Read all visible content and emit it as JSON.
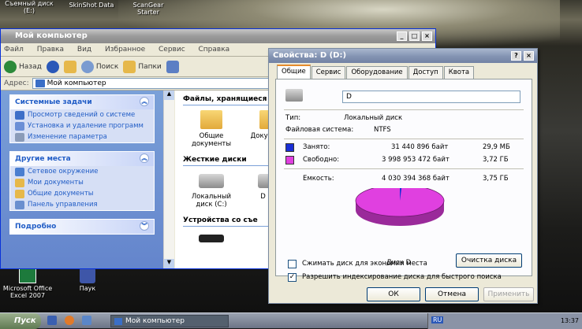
{
  "desktop": {
    "icons_top": [
      "Съемный диск\n(E:)",
      "SkinShot Data",
      "ScanGear\nStarter"
    ],
    "excel_icon": "Microsoft Office\nExcel 2007",
    "spider_icon": "Паук"
  },
  "explorer": {
    "title": "Мой компьютер",
    "menu": [
      "Файл",
      "Правка",
      "Вид",
      "Избранное",
      "Сервис",
      "Справка"
    ],
    "toolbar": {
      "back": "Назад",
      "search": "Поиск",
      "folders": "Папки"
    },
    "address_label": "Адрес:",
    "address_value": "Мой компьютер",
    "system_tasks": {
      "title": "Системные задачи",
      "items": [
        "Просмотр сведений о системе",
        "Установка и удаление программ",
        "Изменение параметра"
      ]
    },
    "other_places": {
      "title": "Другие места",
      "items": [
        "Сетевое окружение",
        "Мои документы",
        "Общие документы",
        "Панель управления"
      ]
    },
    "details": {
      "title": "Подробно"
    },
    "section_files": "Файлы, хранящиеся",
    "folders": [
      "Общие документы",
      "Докум Adm"
    ],
    "section_drives": "Жесткие диски",
    "drives": [
      "Локальный диск (C:)",
      "D (D:)"
    ],
    "section_devices": "Устройства со съе"
  },
  "dialog": {
    "title": "Свойства: D (D:)",
    "tabs": [
      "Общие",
      "Сервис",
      "Оборудование",
      "Доступ",
      "Квота"
    ],
    "selected_tab": "Общие",
    "name_value": "D",
    "type_label": "Тип:",
    "type_value": "Локальный диск",
    "fs_label": "Файловая система:",
    "fs_value": "NTFS",
    "used_label": "Занято:",
    "used_bytes": "31 440 896 байт",
    "used_short": "29,9 МБ",
    "free_label": "Свободно:",
    "free_bytes": "3 998 953 472 байт",
    "free_short": "3,72 ГБ",
    "capacity_label": "Емкость:",
    "capacity_bytes": "4 030 394 368 байт",
    "capacity_short": "3,75 ГБ",
    "used_fraction": 0.0078,
    "disk_label": "Диск D",
    "cleanup_button": "Очистка диска",
    "compress_label": "Сжимать диск для экономии места",
    "compress_checked": false,
    "index_label": "Разрешить индексирование диска для быстрого поиска",
    "index_checked": true,
    "ok": "ОК",
    "cancel": "Отмена",
    "apply": "Применить",
    "colors": {
      "used": "#1a2fd6",
      "free": "#e040e0"
    }
  },
  "taskbar": {
    "start": "Пуск",
    "window": "Мой компьютер",
    "lang": "RU",
    "clock": "13:37"
  }
}
